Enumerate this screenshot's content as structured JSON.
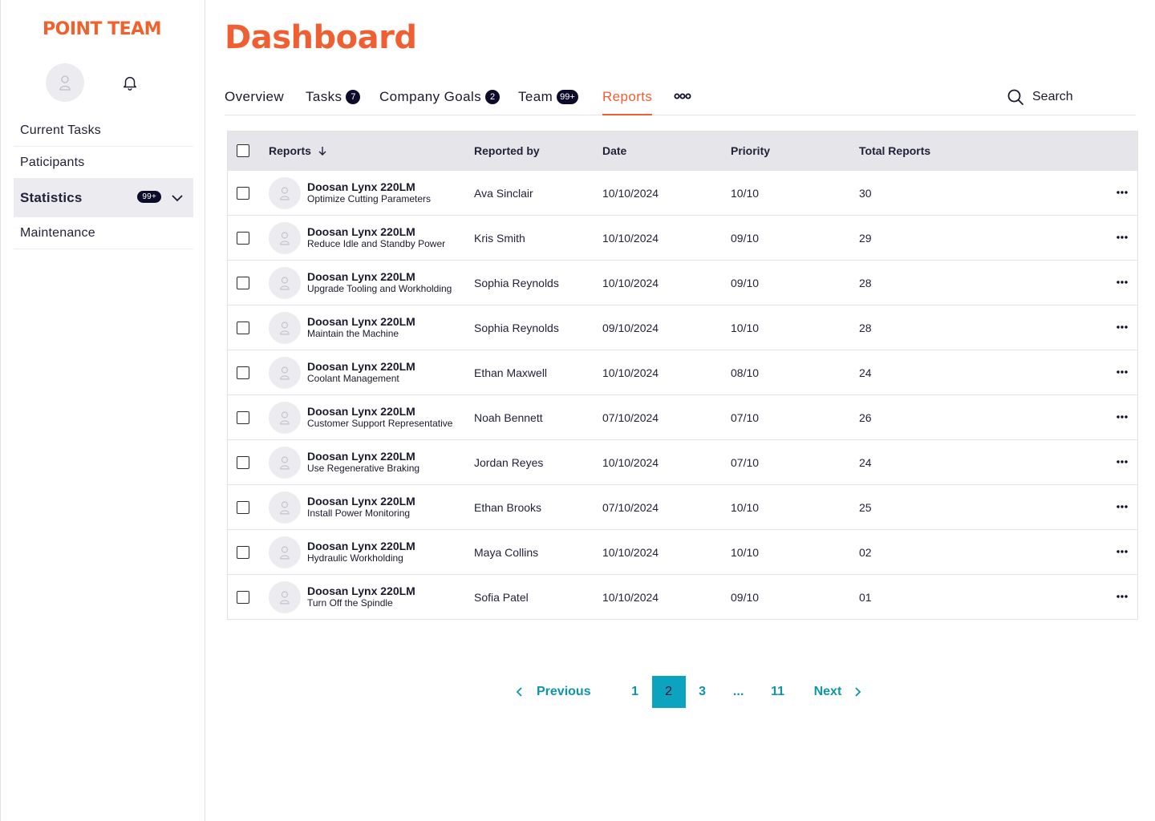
{
  "brand": "POINT TEAM",
  "sidebar": {
    "items": [
      {
        "label": "Current Tasks"
      },
      {
        "label": "Paticipants"
      },
      {
        "label": "Statistics",
        "badge": "99+"
      },
      {
        "label": "Maintenance"
      }
    ]
  },
  "page_title": "Dashboard",
  "tabs": [
    {
      "label": "Overview"
    },
    {
      "label": "Tasks",
      "badge": "7"
    },
    {
      "label": "Company Goals",
      "badge": "2"
    },
    {
      "label": "Team",
      "badge": "99+"
    },
    {
      "label": "Reports"
    }
  ],
  "search": {
    "label": "Search"
  },
  "table": {
    "headers": {
      "reports": "Reports",
      "reported_by": "Reported by",
      "date": "Date",
      "priority": "Priority",
      "total": "Total Reports"
    },
    "rows": [
      {
        "title": "Doosan Lynx 220LM",
        "subtitle": "Optimize Cutting Parameters",
        "reported_by": "Ava Sinclair",
        "date": "10/10/2024",
        "priority": "10/10",
        "total": "30"
      },
      {
        "title": "Doosan Lynx 220LM",
        "subtitle": "Reduce Idle and Standby Power",
        "reported_by": "Kris Smith",
        "date": "10/10/2024",
        "priority": "09/10",
        "total": "29"
      },
      {
        "title": "Doosan Lynx 220LM",
        "subtitle": "Upgrade Tooling and Workholding",
        "reported_by": "Sophia Reynolds",
        "date": "10/10/2024",
        "priority": "09/10",
        "total": "28"
      },
      {
        "title": "Doosan Lynx 220LM",
        "subtitle": "Maintain the Machine",
        "reported_by": "Sophia Reynolds",
        "date": "09/10/2024",
        "priority": "10/10",
        "total": "28"
      },
      {
        "title": "Doosan Lynx 220LM",
        "subtitle": "Coolant Management",
        "reported_by": "Ethan Maxwell",
        "date": "10/10/2024",
        "priority": "08/10",
        "total": "24"
      },
      {
        "title": "Doosan Lynx 220LM",
        "subtitle": "Customer Support Representative",
        "reported_by": "Noah Bennett",
        "date": "07/10/2024",
        "priority": "07/10",
        "total": "26"
      },
      {
        "title": "Doosan Lynx 220LM",
        "subtitle": "Use Regenerative Braking",
        "reported_by": "Jordan Reyes",
        "date": "10/10/2024",
        "priority": "07/10",
        "total": "24"
      },
      {
        "title": "Doosan Lynx 220LM",
        "subtitle": "Install Power Monitoring",
        "reported_by": "Ethan Brooks",
        "date": "07/10/2024",
        "priority": "10/10",
        "total": "25"
      },
      {
        "title": "Doosan Lynx 220LM",
        "subtitle": "Hydraulic Workholding",
        "reported_by": "Maya Collins",
        "date": "10/10/2024",
        "priority": "10/10",
        "total": "02"
      },
      {
        "title": "Doosan Lynx 220LM",
        "subtitle": "Turn Off the Spindle",
        "reported_by": "Sofia Patel",
        "date": "10/10/2024",
        "priority": "09/10",
        "total": "01"
      }
    ]
  },
  "pagination": {
    "previous": "Previous",
    "next": "Next",
    "pages": [
      "1",
      "2",
      "3",
      "...",
      "11"
    ],
    "current": "2"
  },
  "colors": {
    "accent": "#ef5f31",
    "teal": "#0ba3bf",
    "dark": "#0c0c2a"
  }
}
